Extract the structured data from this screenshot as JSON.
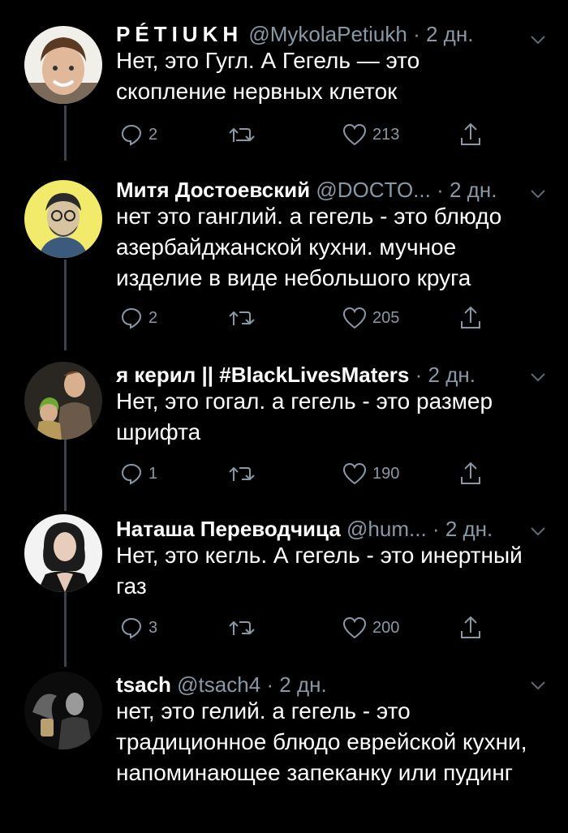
{
  "tweets": [
    {
      "name": "PÉTIUKH",
      "handle": "@MykolaPetiukh",
      "time": "2 дн.",
      "text": "Нет, это Гугл. А Гегель — это скопление нервных клеток",
      "replies": "2",
      "likes": "213"
    },
    {
      "name": "Митя Достоевский",
      "handle": "@DOCTO...",
      "time": "2 дн.",
      "text": "нет это ганглий. а гегель - это блюдо азербайджанской кухни. мучное изделие в виде небольшого круга",
      "replies": "2",
      "likes": "205"
    },
    {
      "name": "я керил || #BlackLivesMaters",
      "handle": "",
      "time": "2 дн.",
      "text": "Нет, это гогал. а гегель - это размер шрифта",
      "replies": "1",
      "likes": "190"
    },
    {
      "name": "Наташа Переводчица",
      "handle": "@hum...",
      "time": "2 дн.",
      "text": "Нет, это кегль. А гегель - это инертный газ",
      "replies": "3",
      "likes": "200"
    },
    {
      "name": "tsach",
      "handle": "@tsach4",
      "time": "2 дн.",
      "text": "нет, это гелий. а гегель - это традиционное блюдо еврейской кухни, напоминающее запеканку или пудинг"
    }
  ],
  "separator": "·",
  "icons": {
    "reply": "reply-icon",
    "retweet": "retweet-icon",
    "like": "heart-icon",
    "share": "share-icon",
    "menu": "chevron-down-icon"
  },
  "colors": {
    "background": "#000000",
    "secondary_text": "#8899a6",
    "thread_line": "#38444d"
  }
}
